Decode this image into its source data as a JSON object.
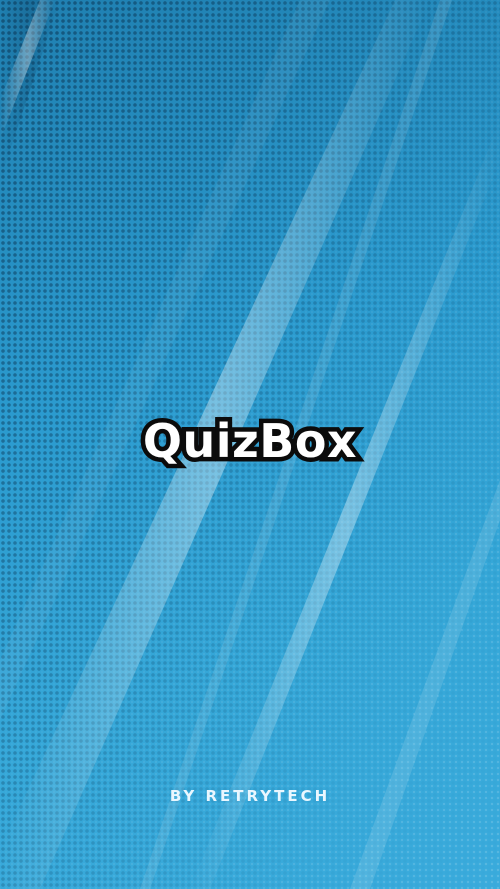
{
  "splash": {
    "app_name": "QuizBox",
    "byline": "BY RETRYTECH"
  },
  "colors": {
    "background_dark": "#1f7fb0",
    "background_light": "#3aabdc",
    "logo_fill": "#ffffff",
    "logo_outline": "#0b0b0b",
    "byline": "#eaf7ff"
  }
}
